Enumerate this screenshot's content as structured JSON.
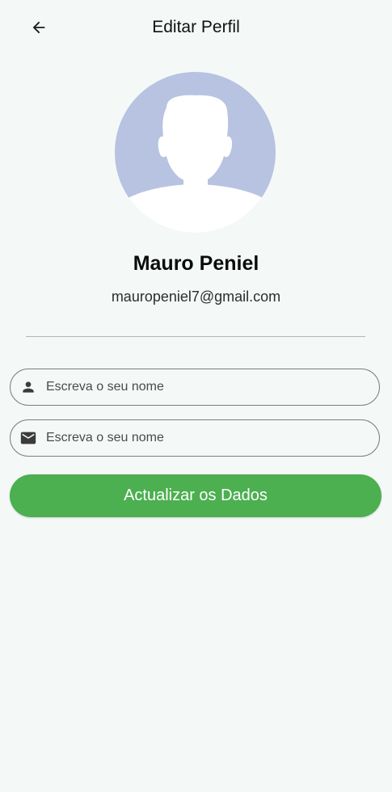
{
  "app_bar": {
    "title": "Editar Perfil",
    "back_icon": "arrow-back-icon"
  },
  "profile": {
    "avatar_icon": "person-silhouette-avatar",
    "name": "Mauro Peniel",
    "email": "mauropeniel7@gmail.com"
  },
  "form": {
    "name_field": {
      "icon": "person-icon",
      "placeholder": "Escreva o seu nome",
      "value": ""
    },
    "email_field": {
      "icon": "mail-icon",
      "placeholder": "Escreva o seu nome",
      "value": ""
    },
    "submit_label": "Actualizar os Dados"
  },
  "colors": {
    "background": "#f4f9f8",
    "accent": "#4caf50",
    "avatar_bg": "#b7c3e1"
  }
}
